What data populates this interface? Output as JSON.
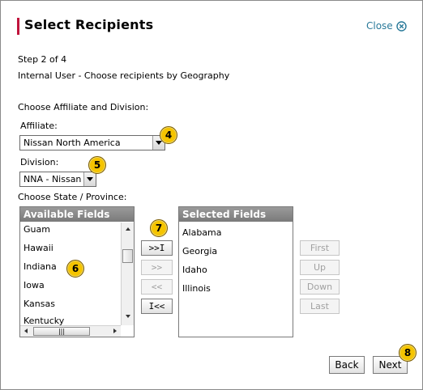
{
  "dialog": {
    "title": "Select Recipients",
    "close_label": "Close",
    "step": "Step 2 of 4",
    "subtitle": "Internal User - Choose recipients by Geography"
  },
  "form": {
    "choose_label": "Choose Affiliate and Division:",
    "affiliate_label": "Affiliate:",
    "affiliate_value": "Nissan North America",
    "division_label": "Division:",
    "division_value": "NNA - Nissan",
    "state_label": "Choose State / Province:"
  },
  "available": {
    "header": "Available Fields",
    "items": [
      "Guam",
      "Hawaii",
      "Indiana",
      "Iowa",
      "Kansas",
      "Kentucky"
    ]
  },
  "selected": {
    "header": "Selected Fields",
    "items": [
      "Alabama",
      "Georgia",
      "Idaho",
      "Illinois"
    ]
  },
  "move_buttons": {
    "add_all": ">>I",
    "add": ">>",
    "remove": "<<",
    "remove_all": "I<<"
  },
  "order_buttons": {
    "first": "First",
    "up": "Up",
    "down": "Down",
    "last": "Last"
  },
  "footer": {
    "back": "Back",
    "next": "Next"
  },
  "callouts": [
    "4",
    "5",
    "6",
    "7",
    "8"
  ],
  "colors": {
    "accent_bar": "#c0143c",
    "link": "#2a7a9a",
    "callout": "#f5c400",
    "list_header": "#8a8a8a"
  }
}
